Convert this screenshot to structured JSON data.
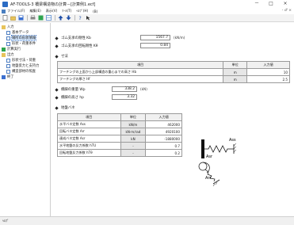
{
  "window": {
    "title": "AF-TOOLS-3 橋梁構造物の計算－[計算例1.ecf]",
    "minimize": "－",
    "maximize": "□",
    "close": "×"
  },
  "menu": {
    "items": [
      "ファイル(F)",
      "編集(E)",
      "表示(V)",
      "ﾂｰﾙ(T)",
      "ﾍﾙﾌﾟ(H)"
    ],
    "extra": "(B)",
    "right": "- ♂ ×"
  },
  "toolbar": {
    "icons": [
      "new-icon",
      "open-icon",
      "save-icon",
      "print-icon",
      "calc-icon",
      "table-icon",
      "up-icon",
      "down-icon",
      "help-icon",
      "whatsthis-icon"
    ]
  },
  "tree": {
    "items": [
      {
        "label": "入力",
        "icon": "folder"
      },
      {
        "label": "基本データ",
        "icon": "doc"
      },
      {
        "label": "場所の形状情報",
        "icon": "doc"
      },
      {
        "label": "形状・荷重条件",
        "icon": "doc"
      },
      {
        "label": "計算実行",
        "icon": "green"
      },
      {
        "label": "出力",
        "icon": "folder"
      },
      {
        "label": "形状寸法・荷重",
        "icon": "doc"
      },
      {
        "label": "地盤反力と支持力",
        "icon": "doc"
      },
      {
        "label": "構造部材の照査",
        "icon": "doc"
      },
      {
        "label": "終了",
        "icon": "blue"
      }
    ]
  },
  "form": {
    "field1": {
      "label": "ゴム支承の剛性 Kb",
      "value": "1567.7",
      "unit": "(kN/m)"
    },
    "field2": {
      "label": "ゴム支承の回転剛性 Kθ",
      "value": "0.84",
      "unit": ""
    },
    "section_label": "寸法",
    "dim_table": {
      "headers": [
        "項目",
        "単位",
        "入力値"
      ],
      "rows": [
        {
          "label": "フーチングの上面から上部構造の重心までの高さ Hb",
          "unit": "m",
          "value": "10"
        },
        {
          "label": "フーチングの厚さ Hf",
          "unit": "m",
          "value": "2.5"
        }
      ]
    },
    "field3": {
      "label": "橋脚の重量 Wp",
      "value": "338.2",
      "unit": "(kN)"
    },
    "field4": {
      "label": "橋脚の高さ hp",
      "value": "3.32",
      "unit": ""
    },
    "spring_label": "地盤バネ",
    "spring_table": {
      "headers": [
        "項目",
        "単位",
        "入力値"
      ],
      "rows": [
        {
          "label": "水平バネ定数 Ass",
          "unit": "kN/m",
          "value": "462000"
        },
        {
          "label": "回転バネ定数 Arr",
          "unit": "kN·m/rad",
          "value": "4920100"
        },
        {
          "label": "連成バネ定数 Asr",
          "unit": "kN",
          "value": "-1880000"
        },
        {
          "label": "水平地盤の反力係数 hTU",
          "unit": "-",
          "value": "0.7"
        },
        {
          "label": "回転地盤反力係数 hTθ",
          "unit": "-",
          "value": "0.2"
        }
      ]
    }
  },
  "diagram": {
    "labels": [
      "Ass",
      "Asr",
      "Arr"
    ]
  },
  "status": {
    "text": "ﾍﾙﾌﾟ"
  },
  "colors": {
    "accent": "#2b6cc4",
    "selected": "#cfe3fb"
  }
}
